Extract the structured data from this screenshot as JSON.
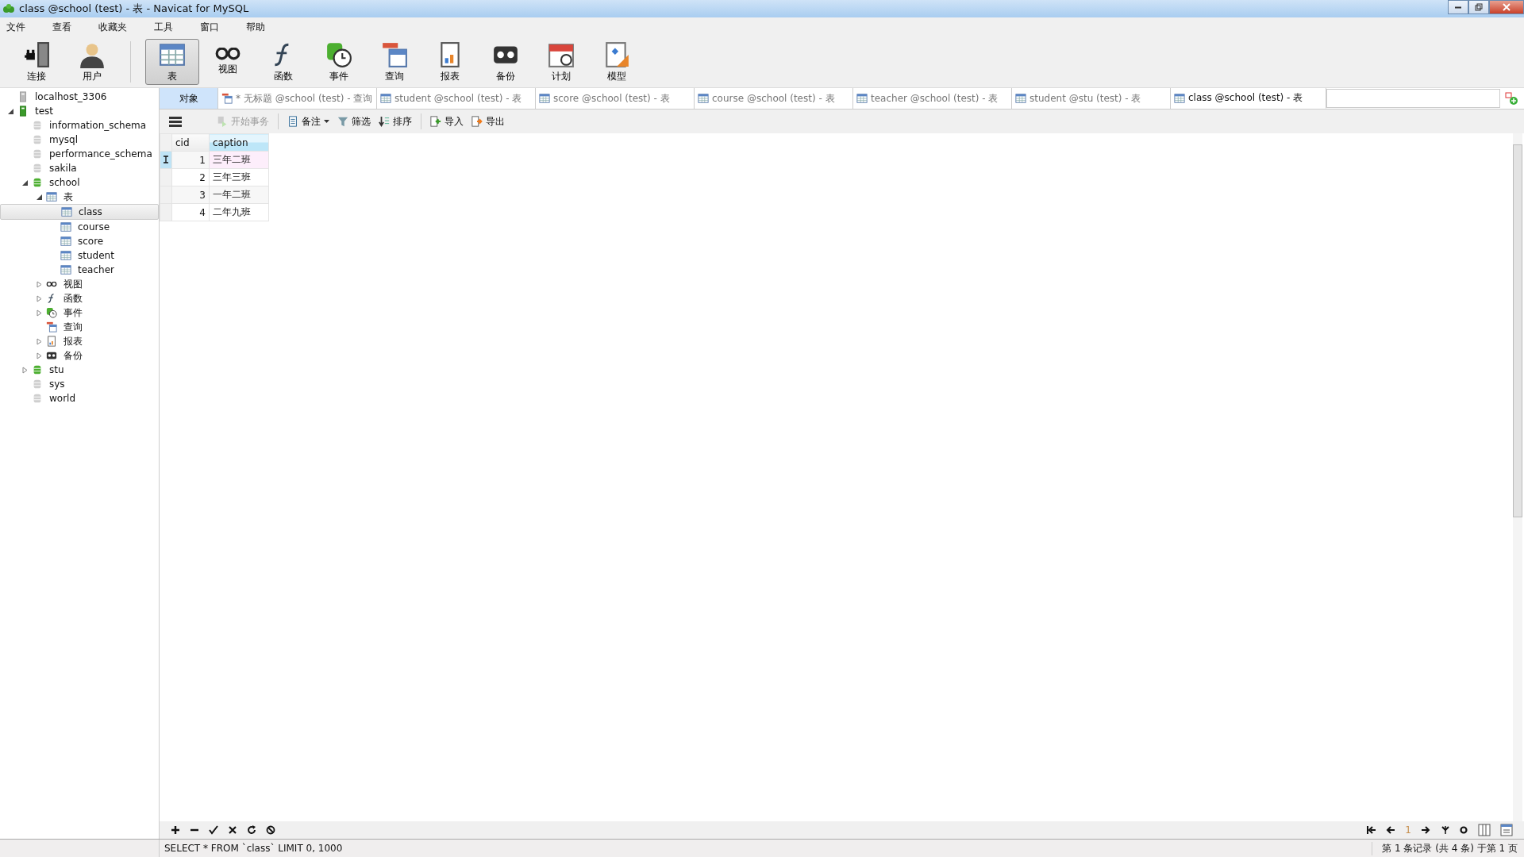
{
  "window": {
    "title": "class @school (test) - 表 - Navicat for MySQL"
  },
  "menu": [
    "文件",
    "查看",
    "收藏夹",
    "工具",
    "窗口",
    "帮助"
  ],
  "toolbar": [
    {
      "label": "连接",
      "kind": "connect",
      "selected": false
    },
    {
      "label": "用户",
      "kind": "user",
      "selected": false
    },
    {
      "label": "表",
      "kind": "table",
      "selected": true
    },
    {
      "label": "视图",
      "kind": "view",
      "selected": false
    },
    {
      "label": "函数",
      "kind": "function",
      "selected": false
    },
    {
      "label": "事件",
      "kind": "event",
      "selected": false
    },
    {
      "label": "查询",
      "kind": "query",
      "selected": false
    },
    {
      "label": "报表",
      "kind": "report",
      "selected": false
    },
    {
      "label": "备份",
      "kind": "backup",
      "selected": false
    },
    {
      "label": "计划",
      "kind": "schedule",
      "selected": false
    },
    {
      "label": "模型",
      "kind": "model",
      "selected": false
    }
  ],
  "tree": [
    {
      "label": "localhost_3306",
      "kind": "server",
      "selected": false
    },
    {
      "label": "test",
      "kind": "server-on",
      "expanded": true,
      "selected": false,
      "children": [
        {
          "label": "information_schema",
          "kind": "db",
          "selected": false
        },
        {
          "label": "mysql",
          "kind": "db",
          "selected": false
        },
        {
          "label": "performance_schema",
          "kind": "db",
          "selected": false
        },
        {
          "label": "sakila",
          "kind": "db",
          "selected": false
        },
        {
          "label": "school",
          "kind": "db-on",
          "expanded": true,
          "selected": false,
          "children": [
            {
              "label": "表",
              "kind": "table",
              "expanded": true,
              "selected": false,
              "children": [
                {
                  "label": "class",
                  "kind": "table",
                  "selected": true
                },
                {
                  "label": "course",
                  "kind": "table",
                  "selected": false
                },
                {
                  "label": "score",
                  "kind": "table",
                  "selected": false
                },
                {
                  "label": "student",
                  "kind": "table",
                  "selected": false
                },
                {
                  "label": "teacher",
                  "kind": "table",
                  "selected": false
                }
              ]
            },
            {
              "label": "视图",
              "kind": "view",
              "expanded": false,
              "selected": false
            },
            {
              "label": "函数",
              "kind": "function",
              "expanded": false,
              "selected": false
            },
            {
              "label": "事件",
              "kind": "event",
              "expanded": false,
              "selected": false
            },
            {
              "label": "查询",
              "kind": "query",
              "selected": false
            },
            {
              "label": "报表",
              "kind": "report",
              "expanded": false,
              "selected": false
            },
            {
              "label": "备份",
              "kind": "backup",
              "expanded": false,
              "selected": false
            }
          ]
        },
        {
          "label": "stu",
          "kind": "db-on",
          "expanded": false,
          "selected": false
        },
        {
          "label": "sys",
          "kind": "db",
          "selected": false
        },
        {
          "label": "world",
          "kind": "db",
          "selected": false
        }
      ]
    }
  ],
  "tabs": [
    {
      "label": "对象",
      "kind": "objects",
      "selected": false
    },
    {
      "label": "* 无标题 @school (test) - 查询",
      "kind": "query",
      "selected": false
    },
    {
      "label": "student @school (test) - 表",
      "kind": "table",
      "selected": false
    },
    {
      "label": "score @school (test) - 表",
      "kind": "table",
      "selected": false
    },
    {
      "label": "course @school (test) - 表",
      "kind": "table",
      "selected": false
    },
    {
      "label": "teacher @school (test) - 表",
      "kind": "table",
      "selected": false
    },
    {
      "label": "student @stu (test) - 表",
      "kind": "table",
      "selected": false
    },
    {
      "label": "class @school (test) - 表",
      "kind": "table",
      "selected": true
    }
  ],
  "actions": [
    {
      "label": "开始事务",
      "kind": "transaction",
      "disabled": true
    },
    {
      "label": "备注",
      "kind": "memo",
      "disabled": false
    },
    {
      "label": "筛选",
      "kind": "filter",
      "disabled": false
    },
    {
      "label": "排序",
      "kind": "sort",
      "disabled": false
    },
    {
      "label": "导入",
      "kind": "import",
      "disabled": false
    },
    {
      "label": "导出",
      "kind": "export",
      "disabled": false
    }
  ],
  "table": {
    "columns": [
      "cid",
      "caption"
    ],
    "rows": [
      {
        "cells": [
          "1",
          "三年二班"
        ],
        "selected": true
      },
      {
        "cells": [
          "2",
          "三年三班"
        ],
        "selected": false
      },
      {
        "cells": [
          "3",
          "一年二班"
        ],
        "selected": false
      },
      {
        "cells": [
          "4",
          "二年九班"
        ],
        "selected": false
      }
    ]
  },
  "page_number": "1",
  "status_bar": {
    "sql": "SELECT * FROM `class` LIMIT 0, 1000",
    "records": "第 1 条记录 (共 4 条) 于第 1 页"
  }
}
